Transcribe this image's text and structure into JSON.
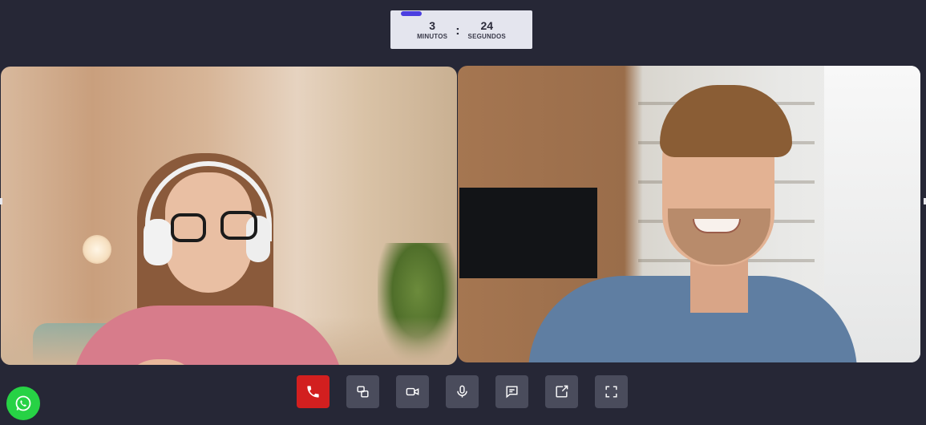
{
  "timer": {
    "minutes_value": "3",
    "minutes_label": "MINUTOS",
    "separator": ":",
    "seconds_value": "24",
    "seconds_label": "SEGUNDOS"
  },
  "colors": {
    "background": "#262736",
    "timer_accent": "#4b3ee0",
    "hangup": "#d21f1f",
    "control": "#4a4c5c",
    "whatsapp": "#27d245"
  },
  "video_tiles": [
    {
      "participant": "left-participant",
      "icon": "video-feed"
    },
    {
      "participant": "right-participant",
      "icon": "video-feed"
    }
  ],
  "controls": [
    {
      "icon": "phone-hangup-icon"
    },
    {
      "icon": "switch-layout-icon"
    },
    {
      "icon": "video-camera-icon"
    },
    {
      "icon": "microphone-icon"
    },
    {
      "icon": "chat-icon"
    },
    {
      "icon": "share-screen-icon"
    },
    {
      "icon": "fullscreen-icon"
    }
  ],
  "floating": {
    "icon": "whatsapp-icon"
  }
}
